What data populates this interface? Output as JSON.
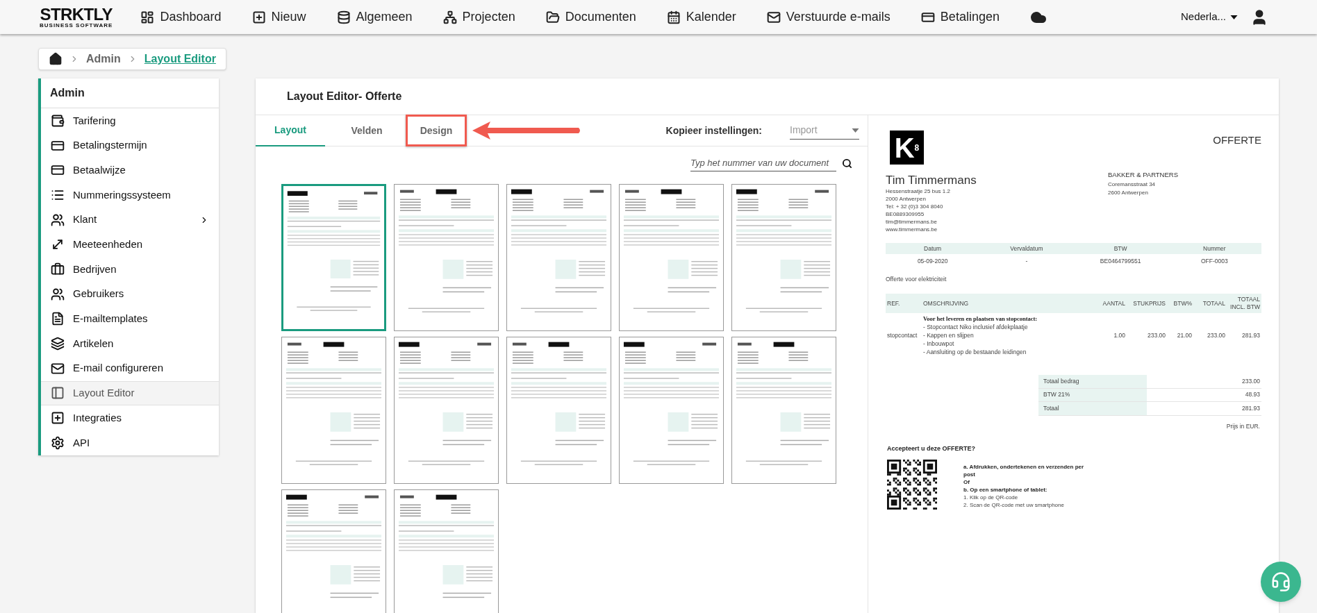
{
  "nav": {
    "logo": {
      "name": "STRKTLY",
      "tagline": "BUSINESS SOFTWARE"
    },
    "items": [
      {
        "label": "Dashboard"
      },
      {
        "label": "Nieuw"
      },
      {
        "label": "Algemeen"
      },
      {
        "label": "Projecten"
      },
      {
        "label": "Documenten"
      },
      {
        "label": "Kalender"
      },
      {
        "label": "Verstuurde e-mails"
      },
      {
        "label": "Betalingen"
      }
    ],
    "language": "Nederla..."
  },
  "breadcrumb": [
    {
      "label": "Admin",
      "selected": false
    },
    {
      "label": "Layout Editor",
      "selected": true
    }
  ],
  "sidebar": {
    "title": "Admin",
    "items": [
      {
        "label": "Tarifering",
        "selected": false,
        "expandable": false
      },
      {
        "label": "Betalingstermijn",
        "selected": false,
        "expandable": false
      },
      {
        "label": "Betaalwijze",
        "selected": false,
        "expandable": false
      },
      {
        "label": "Nummeringssysteem",
        "selected": false,
        "expandable": false
      },
      {
        "label": "Klant",
        "selected": false,
        "expandable": true
      },
      {
        "label": "Meeteenheden",
        "selected": false,
        "expandable": false
      },
      {
        "label": "Bedrijven",
        "selected": false,
        "expandable": false
      },
      {
        "label": "Gebruikers",
        "selected": false,
        "expandable": false
      },
      {
        "label": "E-mailtemplates",
        "selected": false,
        "expandable": false
      },
      {
        "label": "Artikelen",
        "selected": false,
        "expandable": false
      },
      {
        "label": "E-mail configureren",
        "selected": false,
        "expandable": false
      },
      {
        "label": "Layout Editor",
        "selected": true,
        "expandable": false
      },
      {
        "label": "Integraties",
        "selected": false,
        "expandable": false
      },
      {
        "label": "API",
        "selected": false,
        "expandable": false
      }
    ]
  },
  "editor": {
    "title": "Layout Editor- Offerte",
    "tabs": [
      {
        "label": "Layout",
        "selected": true,
        "highlighted": false
      },
      {
        "label": "Velden",
        "selected": false,
        "highlighted": false
      },
      {
        "label": "Design",
        "selected": false,
        "highlighted": true
      }
    ],
    "copy_settings": {
      "label": "Kopieer instellingen:",
      "placeholder": "Import"
    },
    "search": {
      "placeholder": "Typ het nummer van uw document"
    },
    "templates": [
      {
        "selected": true
      },
      {
        "selected": false
      },
      {
        "selected": false
      },
      {
        "selected": false
      },
      {
        "selected": false
      },
      {
        "selected": false
      },
      {
        "selected": false
      },
      {
        "selected": false
      },
      {
        "selected": false
      },
      {
        "selected": false
      },
      {
        "selected": false
      },
      {
        "selected": false
      }
    ]
  },
  "preview": {
    "logo": {
      "letter": "K",
      "index": "8"
    },
    "doc_type": "OFFERTE",
    "sender": {
      "name": "Tim Timmermans",
      "lines": [
        "Hessenstraatje 25 bus 1.2",
        "2000 Antwerpen",
        "Tel: + 32 (0)3 304 8040",
        "BE0889309955",
        "tim@timmermans.be",
        "www.timmermans.be"
      ]
    },
    "recipient": {
      "name": "BAKKER & PARTNERS",
      "lines": [
        "Coremansstraat 34",
        "2600 Antwerpen"
      ]
    },
    "meta": {
      "columns": [
        "Datum",
        "Vervaldatum",
        "BTW",
        "Nummer"
      ],
      "values": [
        "05-09-2020",
        "-",
        "BE0464799551",
        "OFF-0003"
      ]
    },
    "subject": "Offerte voor elektriciteit",
    "columns": [
      "REF.",
      "OMSCHRIJVING",
      "AANTAL",
      "STUKPRIJS",
      "BTW%",
      "TOTAAL",
      "TOTAAL INCL. BTW"
    ],
    "rows": [
      {
        "ref": "stopcontact",
        "heading": "Voor het leveren en plaatsen van stopcontact:",
        "lines": [
          "- Stopcontact Niko inclusief afdekplaatje",
          "- Kappen en slijpen",
          "- Inbouwpot",
          "- Aansluiting op de bestaande leidingen"
        ],
        "values": [
          "1.00",
          "233.00",
          "21.00",
          "233.00",
          "281.93"
        ]
      }
    ],
    "totals": [
      {
        "label": "Totaal bedrag",
        "value": "233.00"
      },
      {
        "label": "BTW 21%",
        "value": "48.93"
      },
      {
        "label": "Totaal",
        "value": "281.93"
      }
    ],
    "currency_note": "Prijs in EUR.",
    "acceptance": {
      "title": "Accepteert u deze OFFERTE?",
      "steps": [
        {
          "text": "a. Afdrukken, ondertekenen en verzenden per post",
          "bold": true
        },
        {
          "text": "Of",
          "bold": true
        },
        {
          "text": "b. Op een smartphone of tablet:",
          "bold": true
        },
        {
          "text": "1. Klik op de QR-code",
          "bold": false
        },
        {
          "text": "2. Scan de QR-code met uw smartphone",
          "bold": false
        }
      ]
    }
  }
}
